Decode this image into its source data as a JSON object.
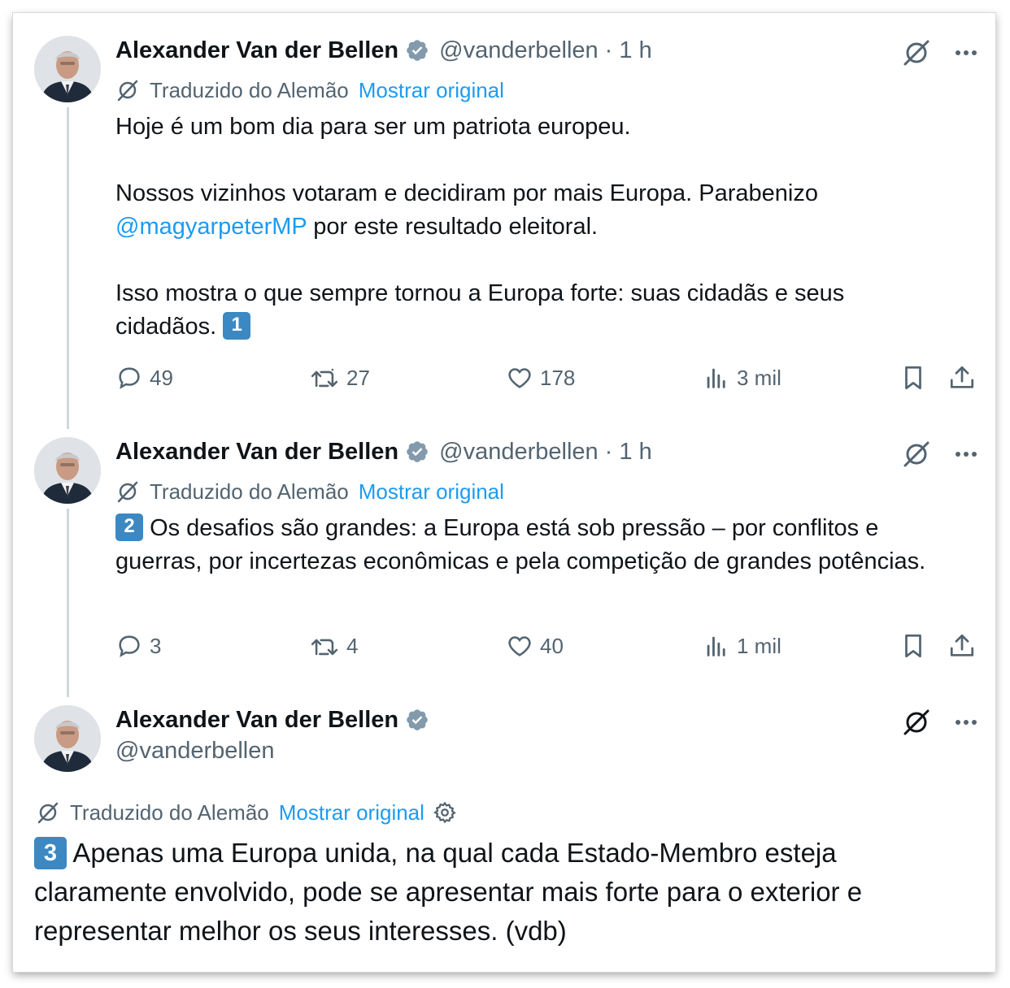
{
  "tweets": [
    {
      "name": "Alexander Van der Bellen",
      "handle": "@vanderbellen",
      "time": "· 1 h",
      "translated_label": "Traduzido do Alemão",
      "show_original": "Mostrar original",
      "text": {
        "p1": "Hoje é um bom dia para ser um patriota europeu.",
        "p2_a": "Nossos vizinhos votaram e decidiram por mais Europa. Parabenizo",
        "p2_mention": "@magyarpeterMP",
        "p2_b": " por este resultado eleitoral.",
        "p3": "Isso mostra o que sempre tornou a Europa forte: suas cidadãs e seus cidadãos.",
        "keycap": "1"
      },
      "stats": {
        "replies": "49",
        "reposts": "27",
        "likes": "178",
        "views": "3 mil"
      }
    },
    {
      "name": "Alexander Van der Bellen",
      "handle": "@vanderbellen",
      "time": "· 1 h",
      "translated_label": "Traduzido do Alemão",
      "show_original": "Mostrar original",
      "text": {
        "keycap": "2",
        "p1": "Os desafios são grandes: a Europa está sob pressão – por conflitos e guerras, por incertezas econômicas e pela competição de grandes potências."
      },
      "stats": {
        "replies": "3",
        "reposts": "4",
        "likes": "40",
        "views": "1 mil"
      }
    },
    {
      "name": "Alexander Van der Bellen",
      "handle": "@vanderbellen",
      "translated_label": "Traduzido do Alemão",
      "show_original": "Mostrar original",
      "text": {
        "keycap": "3",
        "p1": "Apenas uma Europa unida, na qual cada Estado-Membro esteja claramente envolvido, pode se apresentar mais forte para o exterior e representar melhor os seus interesses. (vdb)"
      }
    }
  ],
  "icons": {
    "verified": "verified-badge-icon",
    "grok": "grok-icon",
    "more": "more-icon",
    "translate": "translate-icon",
    "reply": "reply-icon",
    "repost": "repost-icon",
    "like": "like-icon",
    "views": "views-icon",
    "bookmark": "bookmark-icon",
    "share": "share-icon",
    "settings": "settings-icon"
  },
  "colors": {
    "link": "#1d9bf0",
    "muted": "#536471",
    "text": "#0f1419",
    "keycap": "#3b88c3"
  }
}
